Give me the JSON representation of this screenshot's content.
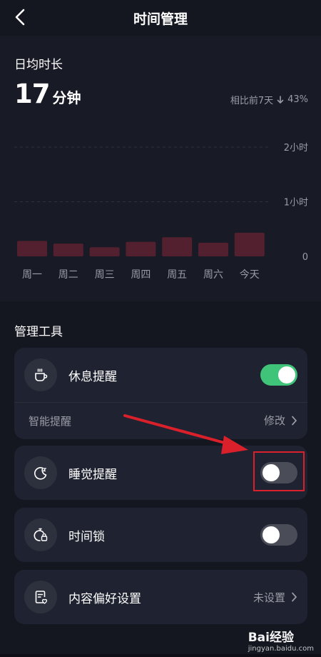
{
  "header": {
    "title": "时间管理"
  },
  "stats": {
    "label": "日均时长",
    "value": "17",
    "unit": "分钟",
    "compare_label": "相比前7天",
    "compare_change": "43%"
  },
  "chart_data": {
    "type": "bar",
    "categories": [
      "周一",
      "周二",
      "周三",
      "周四",
      "周五",
      "周六",
      "今天"
    ],
    "values": [
      17,
      14,
      10,
      16,
      21,
      15,
      26
    ],
    "unit": "minutes",
    "y_ticks": [
      "2小时",
      "1小时",
      "0"
    ],
    "ylim": [
      0,
      120
    ],
    "grid": "dashed",
    "bar_color": "#52202e"
  },
  "tools": {
    "title": "管理工具",
    "rest": {
      "label": "休息提醒",
      "on": true,
      "icon": "cup-icon"
    },
    "smart": {
      "label": "智能提醒",
      "action": "修改"
    },
    "sleep": {
      "label": "睡觉提醒",
      "on": false,
      "icon": "moon-icon"
    },
    "lock": {
      "label": "时间锁",
      "on": false,
      "icon": "timer-lock-icon"
    },
    "pref": {
      "label": "内容偏好设置",
      "value": "未设置",
      "icon": "document-heart-icon"
    }
  },
  "watermark": {
    "brand": "Bai经验",
    "url": "jingyan.baidu.com"
  },
  "colors": {
    "accent_on": "#3fc47a",
    "highlight": "#d9202b",
    "background": "#141620",
    "card": "#1f2230"
  }
}
